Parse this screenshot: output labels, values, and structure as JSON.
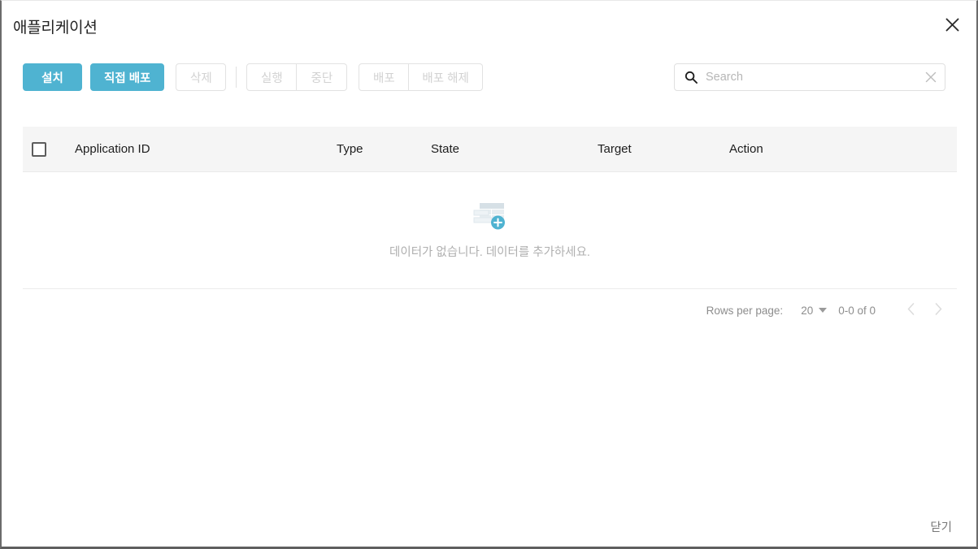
{
  "dialog": {
    "title": "애플리케이션",
    "close_icon": "close-icon",
    "footer_close_label": "닫기"
  },
  "toolbar": {
    "install_label": "설치",
    "direct_deploy_label": "직접 배포",
    "delete_label": "삭제",
    "run_label": "실행",
    "stop_label": "중단",
    "deploy_label": "배포",
    "undeploy_label": "배포 해제"
  },
  "search": {
    "placeholder": "Search",
    "value": "",
    "icon": "search-icon",
    "clear_icon": "close-icon"
  },
  "table": {
    "columns": [
      {
        "key": "application_id",
        "label": "Application ID"
      },
      {
        "key": "type",
        "label": "Type"
      },
      {
        "key": "state",
        "label": "State"
      },
      {
        "key": "target",
        "label": "Target"
      },
      {
        "key": "action",
        "label": "Action"
      }
    ],
    "select_all_checked": false,
    "rows": [],
    "empty_message": "데이터가 없습니다. 데이터를 추가하세요.",
    "empty_icon": "table-add-icon"
  },
  "pagination": {
    "rows_per_page_label": "Rows per page:",
    "rows_per_page_value": "20",
    "range_label": "0-0 of 0",
    "prev_icon": "chevron-left-icon",
    "next_icon": "chevron-right-icon",
    "caret_icon": "chevron-down-icon"
  },
  "colors": {
    "accent": "#4fb3d1",
    "header_bg": "#f5f5f5",
    "disabled_text": "#d2d2d2",
    "muted_text": "#b0b0b0"
  }
}
